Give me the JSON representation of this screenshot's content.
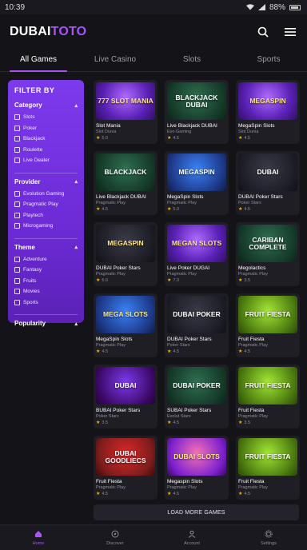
{
  "status": {
    "time": "10:39",
    "battery": "88%"
  },
  "header": {
    "logo_main": "DUBAI",
    "logo_accent": "TOTO",
    "icons": [
      "search-icon",
      "menu-icon"
    ]
  },
  "tabs": [
    {
      "label": "All Games",
      "active": true
    },
    {
      "label": "Live Casino",
      "active": false
    },
    {
      "label": "Slots",
      "active": false
    },
    {
      "label": "Sports",
      "active": false
    }
  ],
  "filter": {
    "title": "FILTER BY",
    "sections": [
      {
        "title": "Category",
        "options": [
          "Slots",
          "Poker",
          "Blackjack",
          "Roulette",
          "Live Dealer"
        ]
      },
      {
        "title": "Provider",
        "options": [
          "Evolution Gaming",
          "Pragmatic Play",
          "Playtech",
          "Microgaming"
        ]
      },
      {
        "title": "Theme",
        "options": [
          "Adventure",
          "Fantasy",
          "Fruits",
          "Movies",
          "Sports"
        ]
      },
      {
        "title": "Popularity",
        "options": []
      }
    ]
  },
  "games": [
    {
      "thumb": "777 SLOT MANIA",
      "title": "Slot Mania",
      "provider": "Slot Dunia",
      "rating": "5.0",
      "style": "t-purple t-gold"
    },
    {
      "thumb": "BLACKJACK DUBAI",
      "title": "Live Blackjack DUBAI",
      "provider": "Evo Gaming",
      "rating": "4.5",
      "style": "t-green"
    },
    {
      "thumb": "MEGASPIN",
      "title": "MegaSpin Slots",
      "provider": "Slot Dunia",
      "rating": "4.5",
      "style": "t-purple t-gold"
    },
    {
      "thumb": "BLACKJACK",
      "title": "Live Blackjack DUBAI",
      "provider": "Pragmatic Play",
      "rating": "4.5",
      "style": "t-green"
    },
    {
      "thumb": "MEGASPIN",
      "title": "MegaSpin Slots",
      "provider": "Pragmatic Play",
      "rating": "5.0",
      "style": "t-blue"
    },
    {
      "thumb": "DUBAI",
      "title": "DUBAI Poker Stars",
      "provider": "Poker Stars",
      "rating": "4.5",
      "style": "t-dark"
    },
    {
      "thumb": "MEGASPIN",
      "title": "DUBAI Poker Stars",
      "provider": "Pragmatic Play",
      "rating": "5.0",
      "style": "t-dark t-gold"
    },
    {
      "thumb": "MEGAN SLOTS",
      "title": "Live Poker DUGAI",
      "provider": "Pragmatic Play",
      "rating": "7.0",
      "style": "t-purple t-gold"
    },
    {
      "thumb": "CARIBAN COMPLETE",
      "title": "Megolactics",
      "provider": "Pragmatic Play",
      "rating": "3.5",
      "style": "t-green"
    },
    {
      "thumb": "MEGA SLOTS",
      "title": "MegaSpin Slots",
      "provider": "Pragmatic Play",
      "rating": "4.5",
      "style": "t-blue t-gold"
    },
    {
      "thumb": "DUBAI POKER",
      "title": "DUBAI Poker Stars",
      "provider": "Poker Stars",
      "rating": "4.5",
      "style": "t-dark"
    },
    {
      "thumb": "FRUIT FIESTA",
      "title": "Fruit Fiesta",
      "provider": "Pragmatic Play",
      "rating": "4.5",
      "style": "t-fruit"
    },
    {
      "thumb": "DUBAI",
      "title": "BUBAI Poker Stars",
      "provider": "Poker Stars",
      "rating": "3.5",
      "style": "t-poker"
    },
    {
      "thumb": "DUBAI POKER",
      "title": "SUBAI Poker Stars",
      "provider": "Evolut Stars",
      "rating": "4.5",
      "style": "t-green"
    },
    {
      "thumb": "FRUIT FIESTA",
      "title": "Fruit Fiesta",
      "provider": "Pragmatic Play",
      "rating": "3.5",
      "style": "t-fruit"
    },
    {
      "thumb": "DUBAI GOODLIECS",
      "title": "Fruit Fiesta",
      "provider": "Pragmatic Play",
      "rating": "4.5",
      "style": "t-red"
    },
    {
      "thumb": "DUBAI SLOTS",
      "title": "Megaspin Slots",
      "provider": "Pragmatic Play",
      "rating": "4.5",
      "style": "t-pink t-gold"
    },
    {
      "thumb": "FRUIT FIESTA",
      "title": "Fruit Fiesta",
      "provider": "Pragmatic Play",
      "rating": "4.5",
      "style": "t-fruit"
    }
  ],
  "load_more": "LOAD MORE GAMES",
  "nav": [
    {
      "label": "Home",
      "icon": "home-icon",
      "active": true
    },
    {
      "label": "Discover",
      "icon": "compass-icon",
      "active": false
    },
    {
      "label": "Account",
      "icon": "user-icon",
      "active": false
    },
    {
      "label": "Settings",
      "icon": "gear-icon",
      "active": false
    }
  ]
}
